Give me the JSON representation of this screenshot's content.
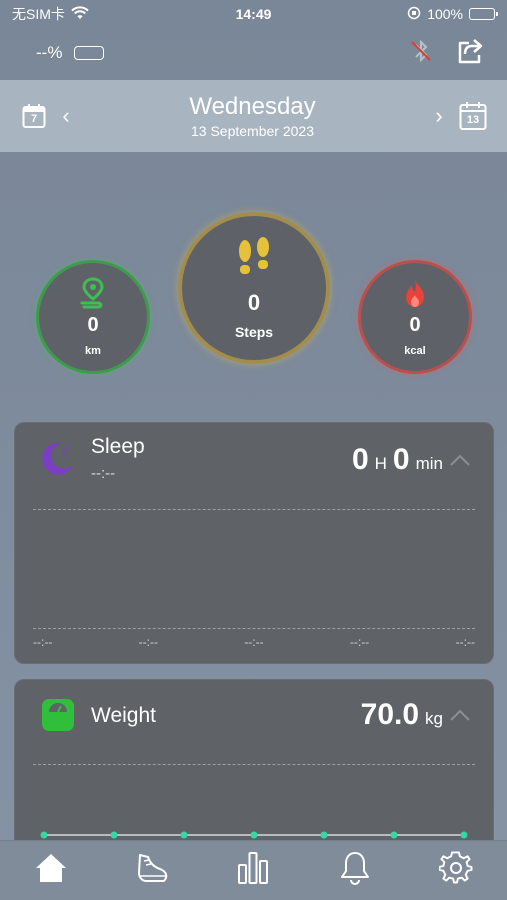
{
  "status_bar": {
    "carrier": "无SIM卡",
    "time": "14:49",
    "battery": "100%",
    "icons": [
      "wifi-icon",
      "orientation-lock-icon",
      "battery-icon"
    ]
  },
  "top_bar": {
    "device_battery": "--%",
    "icons": [
      "device-battery-icon",
      "bluetooth-disconnected-icon",
      "share-icon"
    ]
  },
  "date_bar": {
    "day_name": "Wednesday",
    "date": "13 September 2023",
    "week_calendar_number": "7",
    "month_calendar_number": "13",
    "prev": "‹",
    "next": "›"
  },
  "stats": {
    "distance": {
      "value": "0",
      "unit": "km"
    },
    "steps": {
      "value": "0",
      "unit": "Steps"
    },
    "calories": {
      "value": "0",
      "unit": "kcal"
    }
  },
  "sleep": {
    "title": "Sleep",
    "subtitle": "--:--",
    "hours": "0",
    "hours_unit": "H",
    "minutes": "0",
    "minutes_unit": "min",
    "time_labels": [
      "--:--",
      "--:--",
      "--:--",
      "--:--",
      "--:--"
    ]
  },
  "weight": {
    "title": "Weight",
    "value": "70.0",
    "unit": "kg"
  },
  "bottom_nav": {
    "items": [
      "home-icon",
      "shoe-icon",
      "bar-chart-icon",
      "bell-icon",
      "gear-icon"
    ],
    "active": "home-icon"
  },
  "colors": {
    "distance": "#3fbf4f",
    "steps": "#e6c23a",
    "calories": "#e8423a",
    "sleep_icon": "#7b3fc4",
    "weight_icon": "#2fbf3a",
    "chart_point": "#37d6a3"
  }
}
